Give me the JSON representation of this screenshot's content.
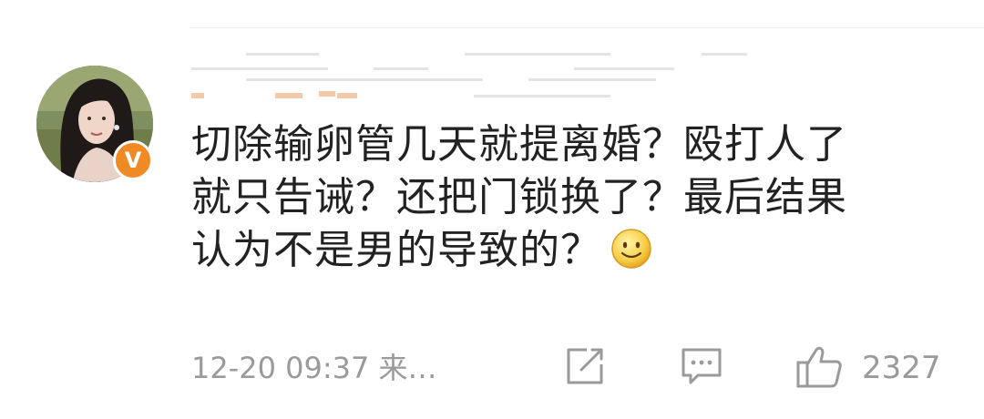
{
  "comment": {
    "lines": [
      "切除输卵管几天就提离婚？殴打人了",
      "就只告诫？还把门锁换了？最后结果",
      "认为不是男的导致的？"
    ],
    "emoji": "smile-emoji",
    "timestamp": "12-20 09:37 来…",
    "like_count": "2327"
  },
  "author": {
    "badge_text": "V",
    "badge_color": "#f08a24"
  },
  "icons": {
    "repost": "edit-share-icon",
    "comment": "comment-icon",
    "like": "thumbs-up-icon"
  }
}
